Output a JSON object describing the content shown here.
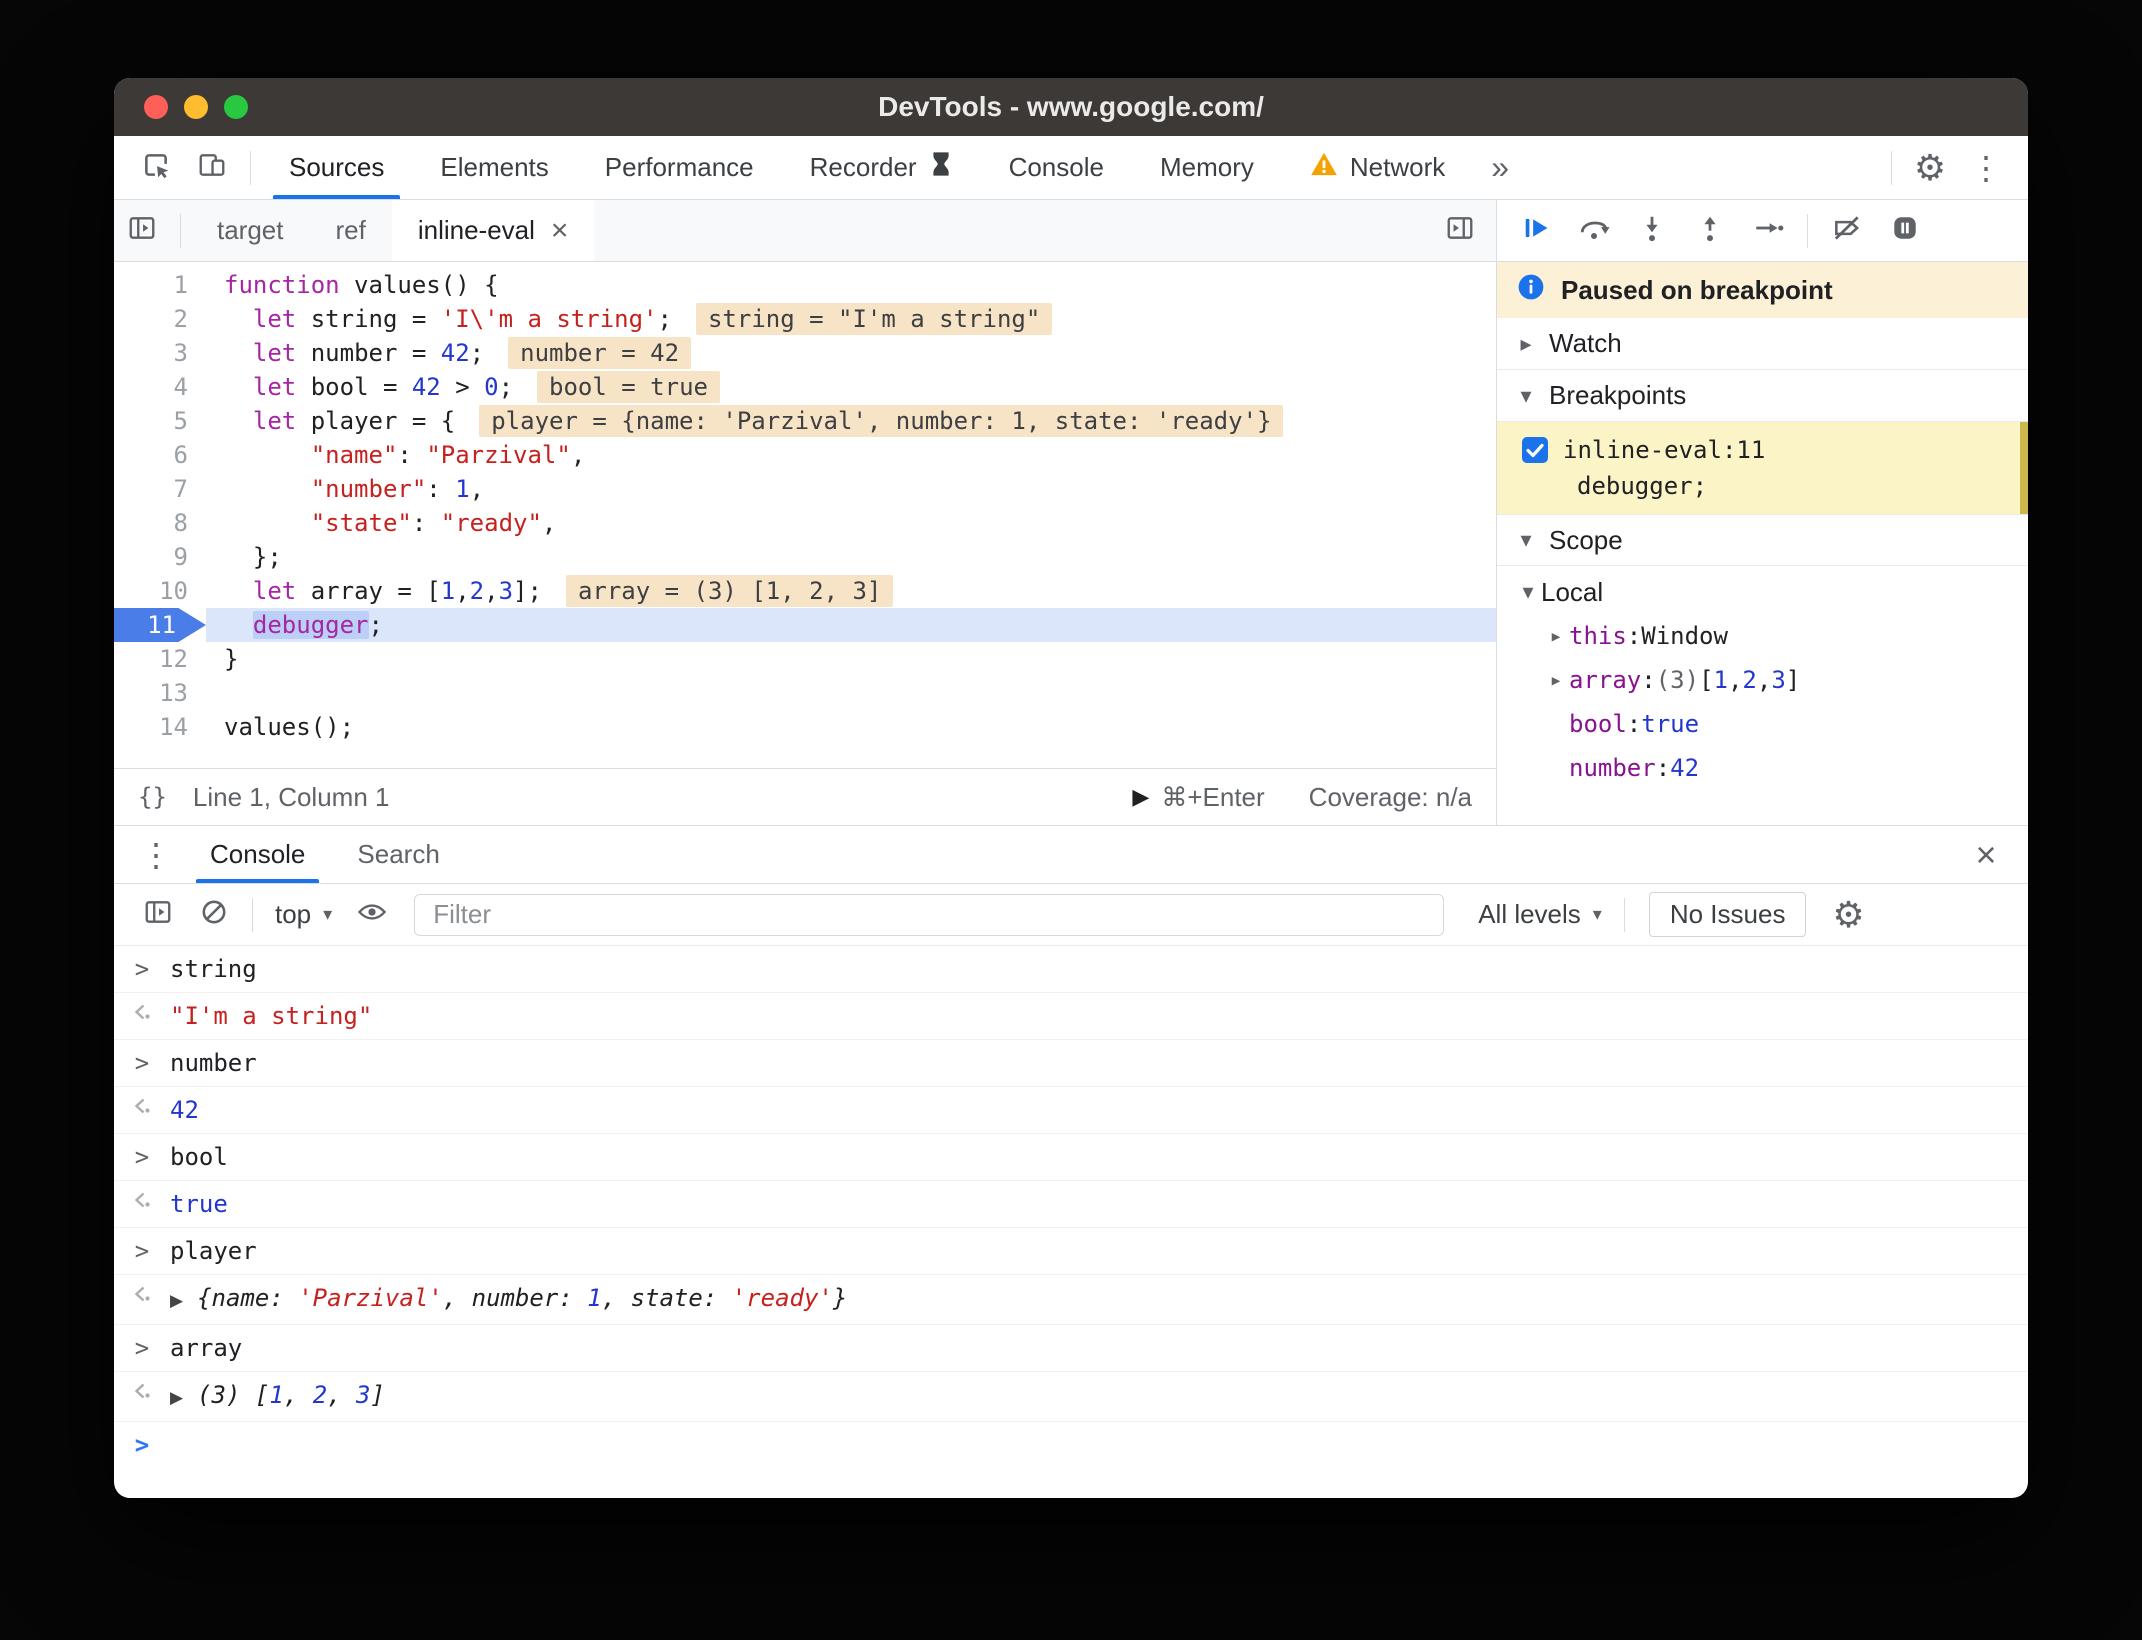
{
  "titlebar": {
    "title": "DevTools - www.google.com/"
  },
  "glyphs": {
    "more": "»",
    "kebab": "⋮",
    "gear": "⚙",
    "close": "×",
    "collapsed": "▸",
    "expanded": "▾",
    "play": "▶",
    "input_chevron": ">",
    "prompt_chevron": ">",
    "expand_preview": "▶"
  },
  "toolbar": {
    "tabs": [
      {
        "label": "Sources",
        "active": true
      },
      {
        "label": "Elements"
      },
      {
        "label": "Performance"
      },
      {
        "label": "Recorder",
        "trailing_icon": "hourglass"
      },
      {
        "label": "Console"
      },
      {
        "label": "Memory"
      },
      {
        "label": "Network",
        "leading_icon": "warning"
      }
    ]
  },
  "sources": {
    "file_tabs": [
      {
        "label": "target"
      },
      {
        "label": "ref"
      },
      {
        "label": "inline-eval",
        "active": true,
        "close_glyph": "×"
      }
    ],
    "code_lines": [
      {
        "n": 1,
        "tokens": [
          [
            "kw",
            "function"
          ],
          [
            "pl",
            " values() {"
          ]
        ]
      },
      {
        "n": 2,
        "tokens": [
          [
            "pl",
            "  "
          ],
          [
            "kw",
            "let"
          ],
          [
            "pl",
            " string = "
          ],
          [
            "str",
            "'I\\'m a string'"
          ],
          [
            "pl",
            ";"
          ],
          [
            "ev",
            "string = \"I'm a string\""
          ]
        ]
      },
      {
        "n": 3,
        "tokens": [
          [
            "pl",
            "  "
          ],
          [
            "kw",
            "let"
          ],
          [
            "pl",
            " number = "
          ],
          [
            "num",
            "42"
          ],
          [
            "pl",
            ";"
          ],
          [
            "ev",
            "number = 42"
          ]
        ]
      },
      {
        "n": 4,
        "tokens": [
          [
            "pl",
            "  "
          ],
          [
            "kw",
            "let"
          ],
          [
            "pl",
            " bool = "
          ],
          [
            "num",
            "42"
          ],
          [
            "pl",
            " > "
          ],
          [
            "num",
            "0"
          ],
          [
            "pl",
            ";"
          ],
          [
            "ev",
            "bool = true"
          ]
        ]
      },
      {
        "n": 5,
        "tokens": [
          [
            "pl",
            "  "
          ],
          [
            "kw",
            "let"
          ],
          [
            "pl",
            " player = {"
          ],
          [
            "ev",
            "player = {name: 'Parzival', number: 1, state: 'ready'}"
          ]
        ]
      },
      {
        "n": 6,
        "tokens": [
          [
            "pl",
            "      "
          ],
          [
            "str",
            "\"name\""
          ],
          [
            "pl",
            ": "
          ],
          [
            "str",
            "\"Parzival\""
          ],
          [
            "pl",
            ","
          ]
        ]
      },
      {
        "n": 7,
        "tokens": [
          [
            "pl",
            "      "
          ],
          [
            "str",
            "\"number\""
          ],
          [
            "pl",
            ": "
          ],
          [
            "num",
            "1"
          ],
          [
            "pl",
            ","
          ]
        ]
      },
      {
        "n": 8,
        "tokens": [
          [
            "pl",
            "      "
          ],
          [
            "str",
            "\"state\""
          ],
          [
            "pl",
            ": "
          ],
          [
            "str",
            "\"ready\""
          ],
          [
            "pl",
            ","
          ]
        ]
      },
      {
        "n": 9,
        "tokens": [
          [
            "pl",
            "  };"
          ]
        ]
      },
      {
        "n": 10,
        "tokens": [
          [
            "pl",
            "  "
          ],
          [
            "kw",
            "let"
          ],
          [
            "pl",
            " array = ["
          ],
          [
            "num",
            "1"
          ],
          [
            "pl",
            ","
          ],
          [
            "num",
            "2"
          ],
          [
            "pl",
            ","
          ],
          [
            "num",
            "3"
          ],
          [
            "pl",
            "];"
          ],
          [
            "ev",
            "array = (3) [1, 2, 3]"
          ]
        ]
      },
      {
        "n": 11,
        "current": true,
        "tokens": [
          [
            "pl",
            "  "
          ],
          [
            "sel",
            "debugger"
          ],
          [
            "pl",
            ";"
          ]
        ]
      },
      {
        "n": 12,
        "tokens": [
          [
            "pl",
            "}"
          ]
        ]
      },
      {
        "n": 13,
        "tokens": []
      },
      {
        "n": 14,
        "tokens": [
          [
            "pl",
            "values();"
          ]
        ]
      }
    ],
    "status": {
      "format_glyph": "{}",
      "position": "Line 1, Column 1",
      "run_hint": "⌘+Enter",
      "coverage": "Coverage: n/a"
    }
  },
  "debugger": {
    "paused_message": "Paused on breakpoint",
    "watch_label": "Watch",
    "breakpoints_label": "Breakpoints",
    "scope_label": "Scope",
    "breakpoint": {
      "checked": true,
      "location": "inline-eval:11",
      "snippet": "debugger;"
    },
    "scope": {
      "group": "Local",
      "vars": [
        {
          "expand": true,
          "name": "this",
          "tokens": [
            [
              "pl",
              "Window"
            ]
          ]
        },
        {
          "expand": true,
          "name": "array",
          "tokens": [
            [
              "gray",
              "(3) "
            ],
            [
              "pl",
              "["
            ],
            [
              "num",
              "1"
            ],
            [
              "pl",
              ", "
            ],
            [
              "num",
              "2"
            ],
            [
              "pl",
              ", "
            ],
            [
              "num",
              "3"
            ],
            [
              "pl",
              "]"
            ]
          ]
        },
        {
          "expand": false,
          "name": "bool",
          "tokens": [
            [
              "num",
              "true"
            ]
          ]
        },
        {
          "expand": false,
          "name": "number",
          "tokens": [
            [
              "num",
              "42"
            ]
          ]
        }
      ]
    }
  },
  "console": {
    "tabs": [
      {
        "label": "Console",
        "active": true
      },
      {
        "label": "Search"
      }
    ],
    "context_selector": "top",
    "caret_glyph": "▾",
    "filter_placeholder": "Filter",
    "levels_label": "All levels",
    "issues_label": "No Issues",
    "messages": [
      {
        "kind": "input",
        "text": "string"
      },
      {
        "kind": "result",
        "tokens": [
          [
            "str",
            "\"I'm a string\""
          ]
        ]
      },
      {
        "kind": "input",
        "text": "number"
      },
      {
        "kind": "result",
        "tokens": [
          [
            "num",
            "42"
          ]
        ]
      },
      {
        "kind": "input",
        "text": "bool"
      },
      {
        "kind": "result",
        "tokens": [
          [
            "num",
            "true"
          ]
        ]
      },
      {
        "kind": "input",
        "text": "player"
      },
      {
        "kind": "result",
        "expand": true,
        "italic": true,
        "tokens": [
          [
            "pl",
            "{name: "
          ],
          [
            "str",
            "'Parzival'"
          ],
          [
            "pl",
            ", number: "
          ],
          [
            "num",
            "1"
          ],
          [
            "pl",
            ", state: "
          ],
          [
            "str",
            "'ready'"
          ],
          [
            "pl",
            "}"
          ]
        ]
      },
      {
        "kind": "input",
        "text": "array"
      },
      {
        "kind": "result",
        "expand": true,
        "italic": true,
        "tokens": [
          [
            "pl",
            "(3) ["
          ],
          [
            "num",
            "1"
          ],
          [
            "pl",
            ", "
          ],
          [
            "num",
            "2"
          ],
          [
            "pl",
            ", "
          ],
          [
            "num",
            "3"
          ],
          [
            "pl",
            "]"
          ]
        ]
      },
      {
        "kind": "prompt"
      }
    ]
  },
  "colors": {
    "accent": "#1a73e8",
    "keyword": "#a626a4",
    "string": "#c5221f",
    "number": "#2337cd",
    "inline_eval_bg": "#f7e3c5",
    "paused_banner_bg": "#fcf1d6",
    "breakpoint_bg": "#fbf4c6",
    "current_line_bg": "#dbe6fa",
    "execution_marker": "#4a7de8",
    "warning": "#f5a200",
    "titlebar_bg": "#3d3937"
  }
}
